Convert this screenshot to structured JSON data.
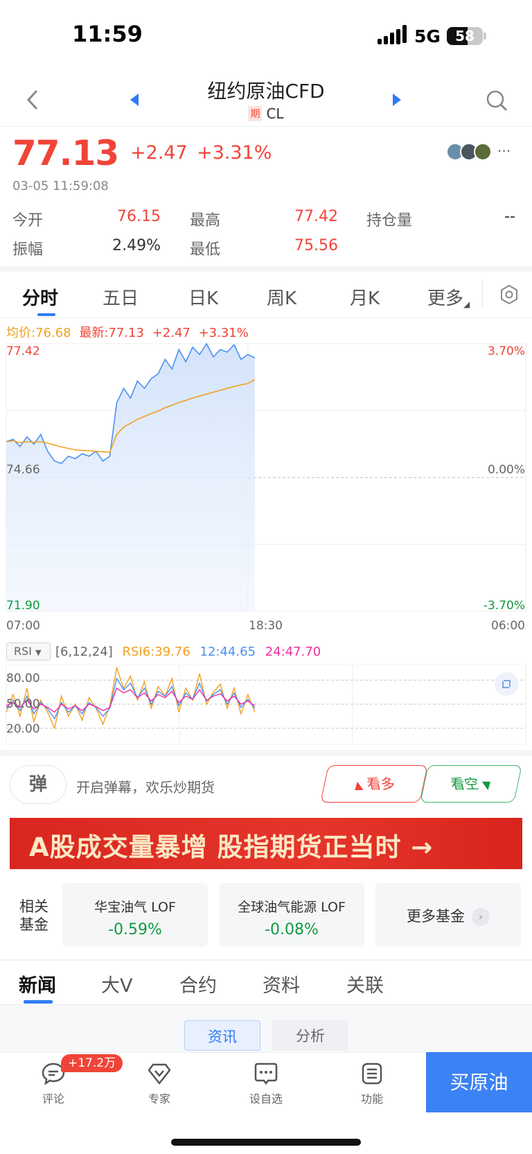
{
  "status_bar": {
    "time": "11:59",
    "network": "5G",
    "battery": "58"
  },
  "nav": {
    "title": "纽约原油CFD",
    "tag": "期",
    "code": "CL"
  },
  "quote": {
    "price": "77.13",
    "change": "+2.47",
    "change_pct": "+3.31%",
    "timestamp": "03-05 11:59:08",
    "stats": {
      "open_label": "今开",
      "open": "76.15",
      "high_label": "最高",
      "high": "77.42",
      "oi_label": "持仓量",
      "oi": "--",
      "amp_label": "振幅",
      "amp": "2.49%",
      "low_label": "最低",
      "low": "75.56"
    }
  },
  "chart_tabs": [
    "分时",
    "五日",
    "日K",
    "周K",
    "月K",
    "更多"
  ],
  "legend": {
    "avg": "均价:76.68",
    "latest": "最新:77.13",
    "chg": "+2.47",
    "pct": "+3.31%"
  },
  "chart_data": {
    "type": "line",
    "title": "",
    "y_ticks_left": [
      "77.42",
      "74.66",
      "71.90"
    ],
    "y_ticks_right": [
      "3.70%",
      "0.00%",
      "-3.70%"
    ],
    "x_ticks": [
      "07:00",
      "18:30",
      "06:00"
    ],
    "ylim": [
      71.9,
      77.42
    ],
    "prev_close": 74.66,
    "series": [
      {
        "name": "最新",
        "values": [
          75.4,
          75.45,
          75.3,
          75.5,
          75.35,
          75.55,
          75.2,
          75.0,
          74.95,
          75.1,
          75.05,
          75.15,
          75.1,
          75.2,
          75.0,
          75.1,
          76.2,
          76.5,
          76.3,
          76.65,
          76.5,
          76.7,
          76.8,
          77.1,
          76.9,
          77.3,
          77.05,
          77.35,
          77.2,
          77.42,
          77.15,
          77.3,
          77.25,
          77.4,
          77.1,
          77.2,
          77.13
        ]
      },
      {
        "name": "均价",
        "values": [
          75.4,
          75.42,
          75.38,
          75.4,
          75.39,
          75.4,
          75.37,
          75.33,
          75.29,
          75.26,
          75.23,
          75.22,
          75.21,
          75.2,
          75.19,
          75.18,
          75.55,
          75.7,
          75.78,
          75.86,
          75.92,
          75.98,
          76.03,
          76.1,
          76.15,
          76.21,
          76.25,
          76.3,
          76.34,
          76.38,
          76.42,
          76.46,
          76.5,
          76.54,
          76.57,
          76.6,
          76.68
        ]
      }
    ],
    "x_count": 80
  },
  "rsi": {
    "box": "RSI",
    "params": "[6,12,24]",
    "rsi6": "RSI6:39.76",
    "rsi12": "12:44.65",
    "rsi24": "24:47.70",
    "levels": [
      "80.00",
      "50.00",
      "20.00"
    ],
    "series": [
      {
        "name": "RSI6",
        "values": [
          40,
          62,
          35,
          70,
          28,
          55,
          40,
          20,
          60,
          35,
          50,
          30,
          58,
          45,
          25,
          48,
          95,
          70,
          85,
          55,
          78,
          45,
          72,
          60,
          82,
          40,
          70,
          55,
          88,
          50,
          65,
          75,
          45,
          70,
          38,
          62,
          40
        ]
      },
      {
        "name": "RSI12",
        "values": [
          45,
          55,
          42,
          60,
          38,
          52,
          44,
          32,
          52,
          40,
          48,
          38,
          52,
          46,
          35,
          45,
          82,
          68,
          76,
          58,
          70,
          50,
          66,
          60,
          72,
          48,
          64,
          56,
          76,
          54,
          62,
          68,
          50,
          64,
          46,
          56,
          45
        ]
      },
      {
        "name": "RSI24",
        "values": [
          48,
          52,
          46,
          55,
          44,
          50,
          46,
          40,
          50,
          44,
          48,
          42,
          50,
          47,
          42,
          46,
          70,
          64,
          68,
          58,
          64,
          54,
          62,
          58,
          66,
          52,
          60,
          56,
          68,
          55,
          60,
          63,
          54,
          60,
          50,
          54,
          48
        ]
      }
    ]
  },
  "danmu": {
    "icon_text": "弹",
    "text": "开启弹幕，欢乐炒期货",
    "bull": "看多",
    "bear": "看空"
  },
  "banner": {
    "text": "A股成交量暴增 股指期货正当时 →"
  },
  "funds": {
    "label": "相关基金",
    "items": [
      {
        "name": "华宝油气 LOF",
        "change": "-0.59%"
      },
      {
        "name": "全球油气能源 LOF",
        "change": "-0.08%"
      }
    ],
    "more": "更多基金"
  },
  "news_tabs": [
    "新闻",
    "大V",
    "合约",
    "资料",
    "关联"
  ],
  "sub_tabs": [
    "资讯",
    "分析"
  ],
  "bottom": {
    "badge": "+17.2万",
    "items": [
      "评论",
      "专家",
      "设自选",
      "功能"
    ],
    "buy": "买原油"
  },
  "colors": {
    "up": "#f04438",
    "down": "#129a3f",
    "accent": "#2f7cf6",
    "avg_line": "#f0a020",
    "price_line": "#4d8ff0",
    "rsi12": "#4d8ff0",
    "rsi24": "#f02ea0"
  }
}
